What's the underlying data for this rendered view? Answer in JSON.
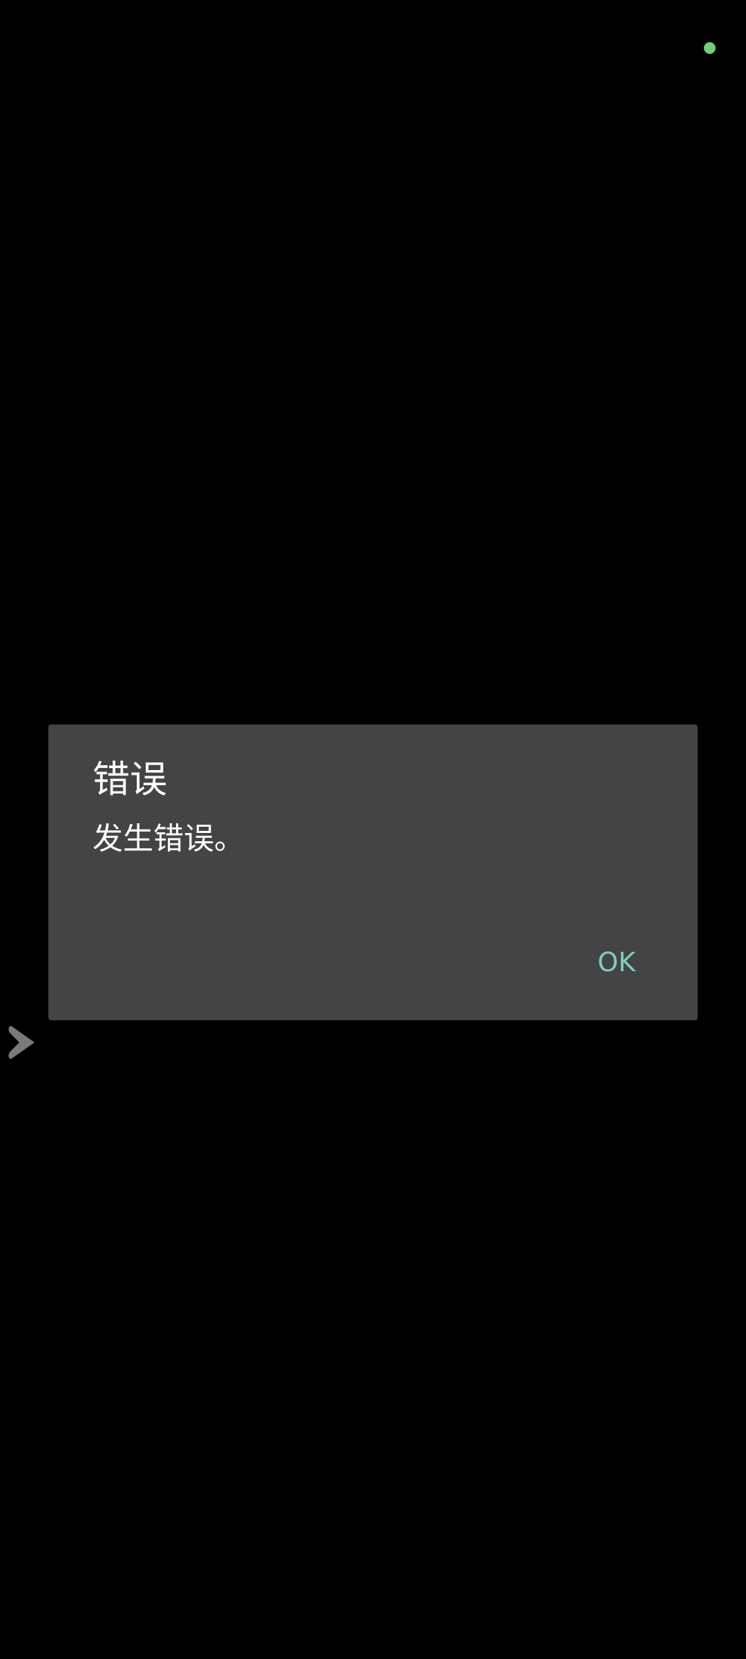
{
  "status": {
    "indicator_color": "#6fd07a"
  },
  "dialog": {
    "title": "错误",
    "message": "发生错误。",
    "ok_label": "OK",
    "accent_color": "#80cbc4"
  },
  "side_handle": {
    "icon": "chevron-right-icon"
  }
}
